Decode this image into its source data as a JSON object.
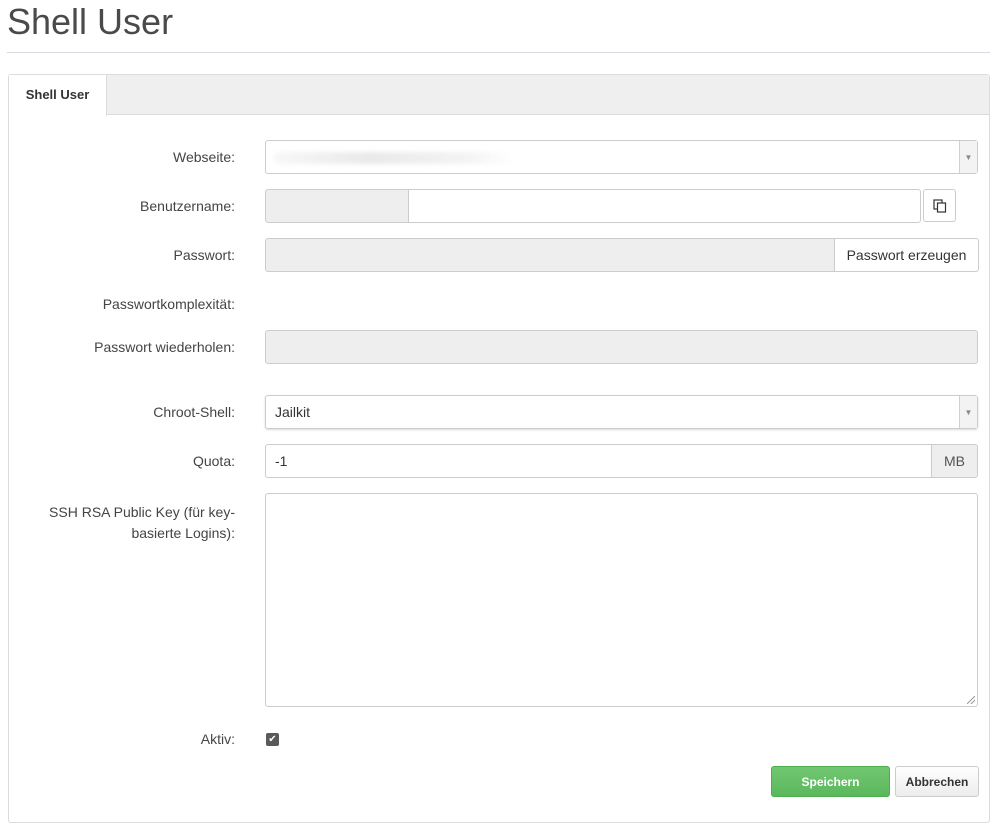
{
  "page": {
    "title": "Shell User"
  },
  "tabs": [
    {
      "label": "Shell User"
    }
  ],
  "form": {
    "webseite": {
      "label": "Webseite:",
      "value": ""
    },
    "benutzername": {
      "label": "Benutzername:",
      "prefix": "",
      "value": ""
    },
    "passwort": {
      "label": "Passwort:",
      "value": "",
      "generate_label": "Passwort erzeugen"
    },
    "komplexitaet": {
      "label": "Passwortkomplexität:"
    },
    "passwort_wiederholen": {
      "label": "Passwort wiederholen:",
      "value": ""
    },
    "chroot": {
      "label": "Chroot-Shell:",
      "value": "Jailkit"
    },
    "quota": {
      "label": "Quota:",
      "value": "-1",
      "unit": "MB"
    },
    "ssh_key": {
      "label_line1": "SSH RSA Public Key (für key-",
      "label_line2": "basierte Logins):",
      "value": ""
    },
    "aktiv": {
      "label": "Aktiv:",
      "checked": true
    }
  },
  "actions": {
    "save_label": "Speichern",
    "cancel_label": "Abbrechen"
  },
  "colors": {
    "primary": "#5cb85c",
    "disabled_bg": "#eeeeee"
  }
}
